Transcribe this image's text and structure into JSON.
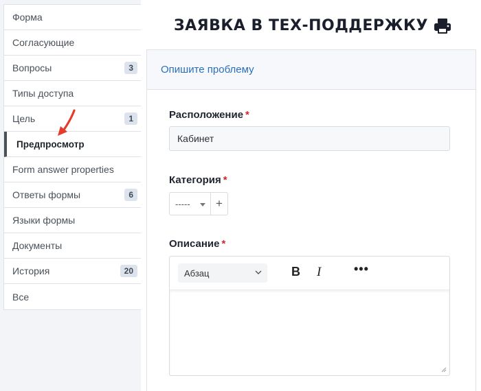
{
  "sidebar": {
    "items": [
      {
        "label": "Форма",
        "badge": null
      },
      {
        "label": "Согласующие",
        "badge": null
      },
      {
        "label": "Вопросы",
        "badge": "3"
      },
      {
        "label": "Типы доступа",
        "badge": null
      },
      {
        "label": "Цель",
        "badge": "1"
      },
      {
        "label": "Предпросмотр",
        "badge": null,
        "active": true
      },
      {
        "label": "Form answer properties",
        "badge": null
      },
      {
        "label": "Ответы формы",
        "badge": "6"
      },
      {
        "label": "Языки формы",
        "badge": null
      },
      {
        "label": "Документы",
        "badge": null
      },
      {
        "label": "История",
        "badge": "20"
      },
      {
        "label": "Все",
        "badge": null
      }
    ]
  },
  "page": {
    "title": "ЗАЯВКА В ТЕХ-ПОДДЕРЖКУ",
    "print_icon": "print-icon"
  },
  "card": {
    "header": "Опишите проблему"
  },
  "form": {
    "location": {
      "label": "Расположение",
      "required_mark": "*",
      "value": "Кабинет"
    },
    "category": {
      "label": "Категория",
      "required_mark": "*",
      "selected": "-----",
      "add_label": "+"
    },
    "description": {
      "label": "Описание",
      "required_mark": "*",
      "format_selected": "Абзац",
      "bold_label": "B",
      "italic_label": "I",
      "more_label": "•••"
    }
  },
  "colors": {
    "accent_link": "#2a6fb8",
    "required": "#d3232b",
    "annotation_arrow": "#e53a2c"
  }
}
